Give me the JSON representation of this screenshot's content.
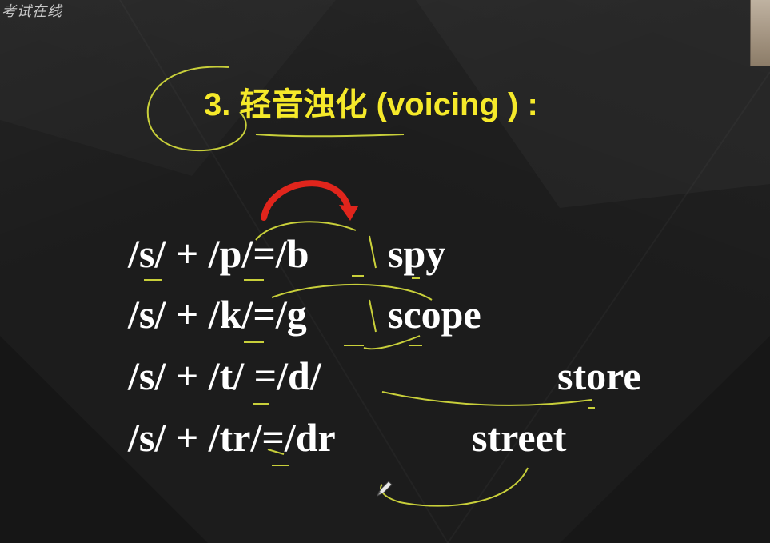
{
  "watermark": "考试在线",
  "title": "3. 轻音浊化 (voicing ) :",
  "rules": [
    {
      "formula": "/s/ + /p/=/b",
      "example": "spy"
    },
    {
      "formula": "/s/ + /k/=/g",
      "example": "scope"
    },
    {
      "formula": "/s/ + /t/ =/d/",
      "example": "store"
    },
    {
      "formula": "/s/ + /tr/=/dr",
      "example": "street"
    }
  ],
  "colors": {
    "background": "#1c1c1c",
    "title": "#f5e92a",
    "body_text": "#ffffff",
    "pen_annotation": "#c8cf3a",
    "arrow": "#e0251c"
  },
  "icons": {
    "cursor": "pen-cursor-icon",
    "arrow": "curved-arrow-icon"
  }
}
